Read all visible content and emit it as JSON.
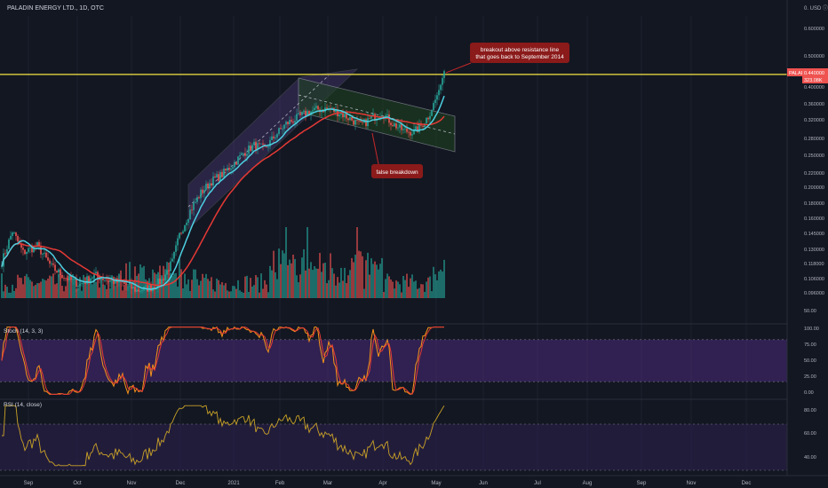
{
  "header": {
    "symbol_title": "PALADIN ENERGY LTD., 1D, OTC"
  },
  "currency_label": "0. USD ⓘ",
  "price_axis": {
    "ticks": [
      "0.600000",
      "0.500000",
      "0.400000",
      "0.360000",
      "0.320000",
      "0.280000",
      "0.250000",
      "0.220000",
      "0.200000",
      "0.180000",
      "0.160000",
      "0.145000",
      "0.130000",
      "0.118000",
      "0.106000",
      "0.096000",
      "50.00"
    ],
    "tag_symbol": "PALAF",
    "tag_price": "0.440000",
    "tag_volume": "323.08K"
  },
  "time_axis": {
    "ticks": [
      "Sep",
      "Oct",
      "Nov",
      "Dec",
      "2021",
      "Feb",
      "Mar",
      "Apr",
      "May",
      "Jun",
      "Jul",
      "Aug",
      "Sep",
      "Nov",
      "Dec"
    ]
  },
  "annotations": {
    "breakout": [
      "breakout above resistance line",
      "that goes back to September 2014"
    ],
    "false_breakdown": "false breakdown"
  },
  "stoch": {
    "title": "Stoch (14, 3, 3)",
    "ticks": [
      "100.00",
      "75.00",
      "50.00",
      "25.00",
      "0.00"
    ]
  },
  "rsi": {
    "title": "RSI (14, close)",
    "ticks": [
      "80.00",
      "60.00",
      "40.00"
    ]
  },
  "colors": {
    "bg": "#131722",
    "up": "#26a69a",
    "down": "#ef5350",
    "resistance": "#f5e642",
    "ma_fast": "#4dd0e1",
    "ma_slow": "#e53935",
    "band": "#7e57c2",
    "stoch_k": "#f7931a",
    "stoch_d": "#e53935",
    "rsi": "#c9a227",
    "annotation": "#8b1a1a"
  },
  "chart_data": {
    "type": "candlestick",
    "symbol": "PALAF",
    "interval": "1D",
    "y_scale": "log",
    "ylim": [
      0.092,
      0.62
    ],
    "resistance_level": 0.43,
    "x_ticks": [
      "Sep",
      "Oct",
      "Nov",
      "Dec",
      "2021",
      "Feb",
      "Mar",
      "Apr",
      "May",
      "Jun",
      "Jul",
      "Aug",
      "Sep",
      "Nov",
      "Dec"
    ],
    "close_path": [
      [
        0,
        0.118
      ],
      [
        6,
        0.146
      ],
      [
        12,
        0.126
      ],
      [
        20,
        0.132
      ],
      [
        28,
        0.114
      ],
      [
        36,
        0.106
      ],
      [
        44,
        0.101
      ],
      [
        52,
        0.108
      ],
      [
        60,
        0.104
      ],
      [
        68,
        0.102
      ],
      [
        76,
        0.097
      ],
      [
        84,
        0.099
      ],
      [
        90,
        0.104
      ],
      [
        96,
        0.118
      ],
      [
        100,
        0.142
      ],
      [
        106,
        0.168
      ],
      [
        112,
        0.19
      ],
      [
        118,
        0.206
      ],
      [
        124,
        0.216
      ],
      [
        130,
        0.231
      ],
      [
        136,
        0.25
      ],
      [
        142,
        0.264
      ],
      [
        148,
        0.257
      ],
      [
        154,
        0.283
      ],
      [
        160,
        0.306
      ],
      [
        166,
        0.318
      ],
      [
        172,
        0.331
      ],
      [
        178,
        0.338
      ],
      [
        184,
        0.339
      ],
      [
        190,
        0.33
      ],
      [
        196,
        0.317
      ],
      [
        202,
        0.302
      ],
      [
        208,
        0.318
      ],
      [
        214,
        0.33
      ],
      [
        220,
        0.306
      ],
      [
        226,
        0.292
      ],
      [
        232,
        0.289
      ],
      [
        236,
        0.302
      ],
      [
        240,
        0.322
      ],
      [
        244,
        0.36
      ],
      [
        247,
        0.4
      ],
      [
        249,
        0.44
      ]
    ],
    "annotations": [
      "breakout above resistance line that goes back to September 2014",
      "false breakdown"
    ],
    "indicators": {
      "stoch": {
        "params": [
          14,
          3,
          3
        ],
        "ylim": [
          0,
          100
        ],
        "bands": [
          20,
          80
        ],
        "last": 95
      },
      "rsi": {
        "params": [
          14
        ],
        "source": "close",
        "ylim": [
          30,
          90
        ],
        "bands": [
          30,
          70
        ],
        "last": 80
      }
    }
  }
}
